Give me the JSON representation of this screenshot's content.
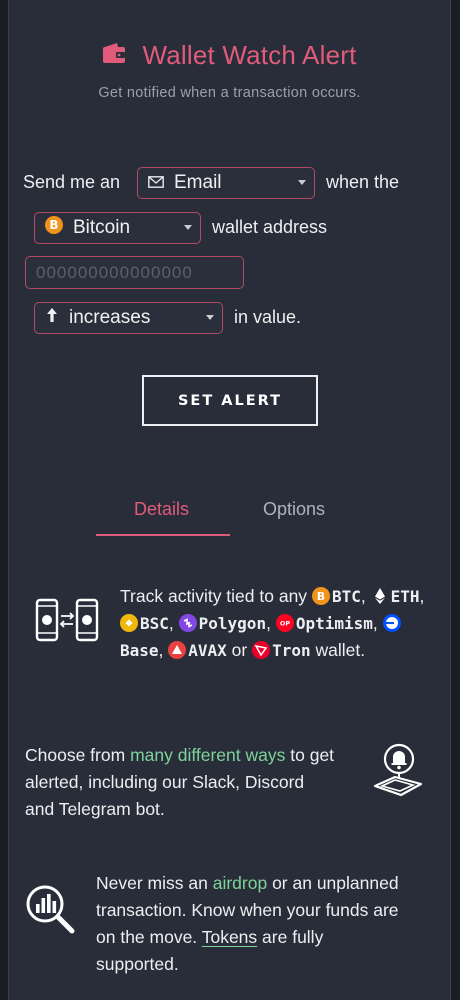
{
  "header": {
    "title": "Wallet Watch Alert",
    "subtitle": "Get notified when a transaction occurs."
  },
  "form": {
    "send_text": "Send me an",
    "channel": "Email",
    "when_text": "when the",
    "coin": "Bitcoin",
    "wallet_text": "wallet address",
    "address_placeholder": "000000000000000",
    "direction": "increases",
    "value_text": "in value.",
    "button": "SET ALERT"
  },
  "tabs": {
    "details": "Details",
    "options": "Options"
  },
  "details": {
    "p1_prefix": "Track activity tied to any",
    "coins": [
      "BTC",
      "ETH",
      "BSC",
      "Polygon",
      "Optimism",
      "Base",
      "AVAX",
      "Tron"
    ],
    "or": "or",
    "wallet": "wallet.",
    "p2_a": "Choose from",
    "p2_link": "many different ways",
    "p2_b": "to get",
    "p2_c": "alerted, including our Slack, Discord",
    "p2_d": "and Telegram bot.",
    "p3_a": "Never miss an",
    "p3_link": "airdrop",
    "p3_b": "or an unplanned",
    "p3_c": "transaction. Know when your funds are",
    "p3_d": "on the move.",
    "p3_link2": "Tokens",
    "p3_e": "are fully",
    "p3_f": "supported."
  },
  "colors": {
    "accent": "#e05c7a",
    "link": "#7ed39a",
    "panel": "#282d39",
    "btc": "#f0931b",
    "bsc": "#f0b90b",
    "polygon": "#8247e5",
    "optimism": "#ff0420",
    "base": "#0052ff",
    "avax": "#e84142",
    "tron": "#eb0029"
  }
}
